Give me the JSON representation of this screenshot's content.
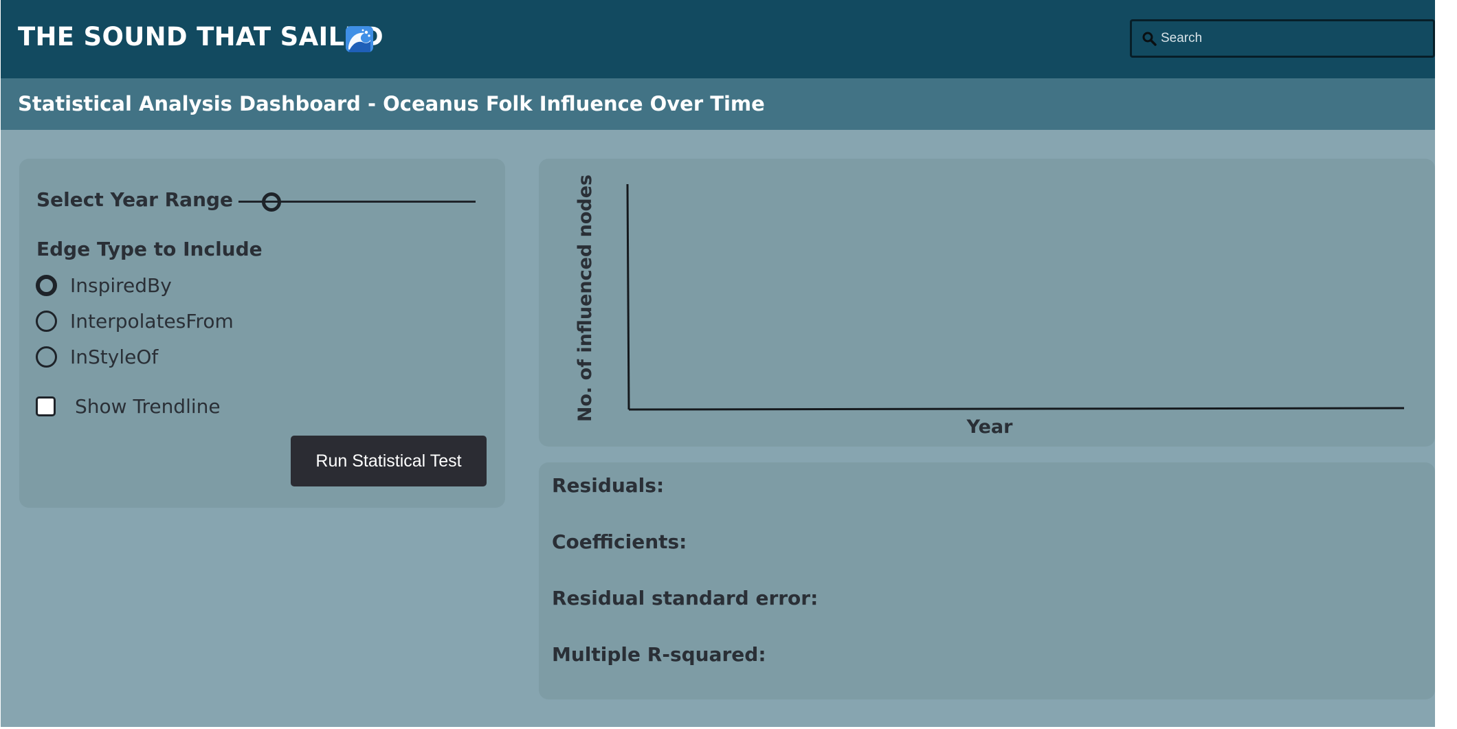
{
  "header": {
    "title": "THE SOUND THAT SAILED",
    "logo_icon": "wave-icon",
    "search": {
      "placeholder": "Search",
      "value": ""
    }
  },
  "subheader": {
    "title": "Statistical Analysis Dashboard - Oceanus Folk Influence Over Time"
  },
  "controls": {
    "year_range_label": "Select Year Range",
    "edge_type_label": "Edge Type to Include",
    "edge_types": [
      {
        "label": "InspiredBy",
        "selected": true
      },
      {
        "label": "InterpolatesFrom",
        "selected": false
      },
      {
        "label": "InStyleOf",
        "selected": false
      }
    ],
    "show_trendline_label": "Show Trendline",
    "show_trendline_checked": false,
    "run_button_label": "Run Statistical Test"
  },
  "chart_data": {
    "type": "line",
    "xlabel": "Year",
    "ylabel": "No. of influenced nodes",
    "series": []
  },
  "stats": {
    "residuals_label": "Residuals:",
    "coefficients_label": "Coefficients:",
    "rse_label": "Residual standard error:",
    "r_squared_label": "Multiple R-squared:"
  },
  "colors": {
    "header_bg": "#124a60",
    "subheader_bg": "#427385",
    "page_bg": "#87a5b0",
    "panel_bg": "#7e9ca5",
    "button_bg": "#2b2c33"
  }
}
